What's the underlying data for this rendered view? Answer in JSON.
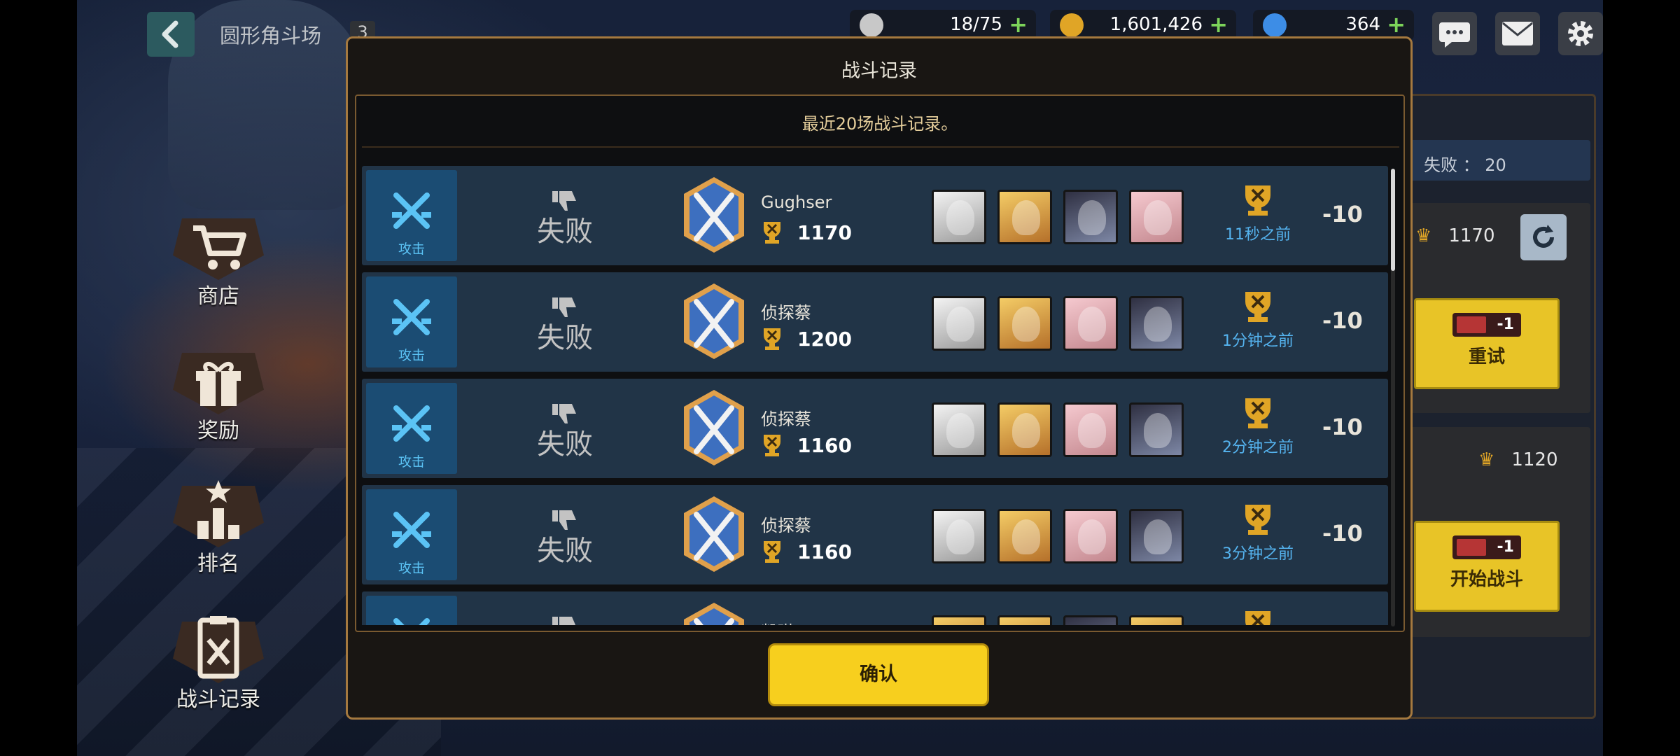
{
  "header": {
    "back_icon": "chevron-left-icon",
    "title": "圆形角斗场",
    "badge": "3",
    "resources": [
      {
        "icon": "coffee-cup-icon",
        "value": "18/75",
        "color": "#c8c8c8"
      },
      {
        "icon": "gold-coin-icon",
        "value": "1,601,426",
        "color": "#e0a526"
      },
      {
        "icon": "blue-gem-icon",
        "value": "364",
        "color": "#3d8de6"
      }
    ],
    "actions": [
      "chat-icon",
      "mail-icon",
      "gear-icon"
    ]
  },
  "side_menu": [
    {
      "label": "商店",
      "icon": "shop-cart-icon"
    },
    {
      "label": "奖励",
      "icon": "gift-icon"
    },
    {
      "label": "排名",
      "icon": "ranking-podium-icon"
    },
    {
      "label": "战斗记录",
      "icon": "battle-record-icon"
    }
  ],
  "right_panel": {
    "fail_text": "失败 ： 20",
    "my_score": "1170",
    "retry_label": "重试",
    "retry_ticket": "-1",
    "opponent_score": "1120",
    "start_label": "开始战斗",
    "start_ticket": "-1"
  },
  "modal": {
    "title": "战斗记录",
    "subtitle": "最近20场战斗记录。",
    "confirm_label": "确认",
    "rows": [
      {
        "type": "攻击",
        "result": "失败",
        "name": "Gughser",
        "score": "1170",
        "heroes": [
          "h-sage",
          "h-blonde",
          "h-dark",
          "h-pink"
        ],
        "time": "11秒之前",
        "delta": "-10"
      },
      {
        "type": "攻击",
        "result": "失败",
        "name": "侦探蔡",
        "score": "1200",
        "heroes": [
          "h-sage",
          "h-blonde",
          "h-pink",
          "h-dark"
        ],
        "time": "1分钟之前",
        "delta": "-10"
      },
      {
        "type": "攻击",
        "result": "失败",
        "name": "侦探蔡",
        "score": "1160",
        "heroes": [
          "h-sage",
          "h-blonde",
          "h-pink",
          "h-dark"
        ],
        "time": "2分钟之前",
        "delta": "-10"
      },
      {
        "type": "攻击",
        "result": "失败",
        "name": "侦探蔡",
        "score": "1160",
        "heroes": [
          "h-sage",
          "h-blonde",
          "h-pink",
          "h-dark"
        ],
        "time": "3分钟之前",
        "delta": "-10"
      },
      {
        "type": "",
        "result": "",
        "name": "凯琳",
        "score": "",
        "heroes": [
          "h-blonde",
          "h-blonde",
          "h-dark",
          "h-blonde"
        ],
        "time": "",
        "delta": ""
      }
    ]
  },
  "colors": {
    "attack_blue": "#5bc3f5",
    "gold_accent": "#a5793f",
    "confirm_yellow": "#f7cf1e"
  }
}
